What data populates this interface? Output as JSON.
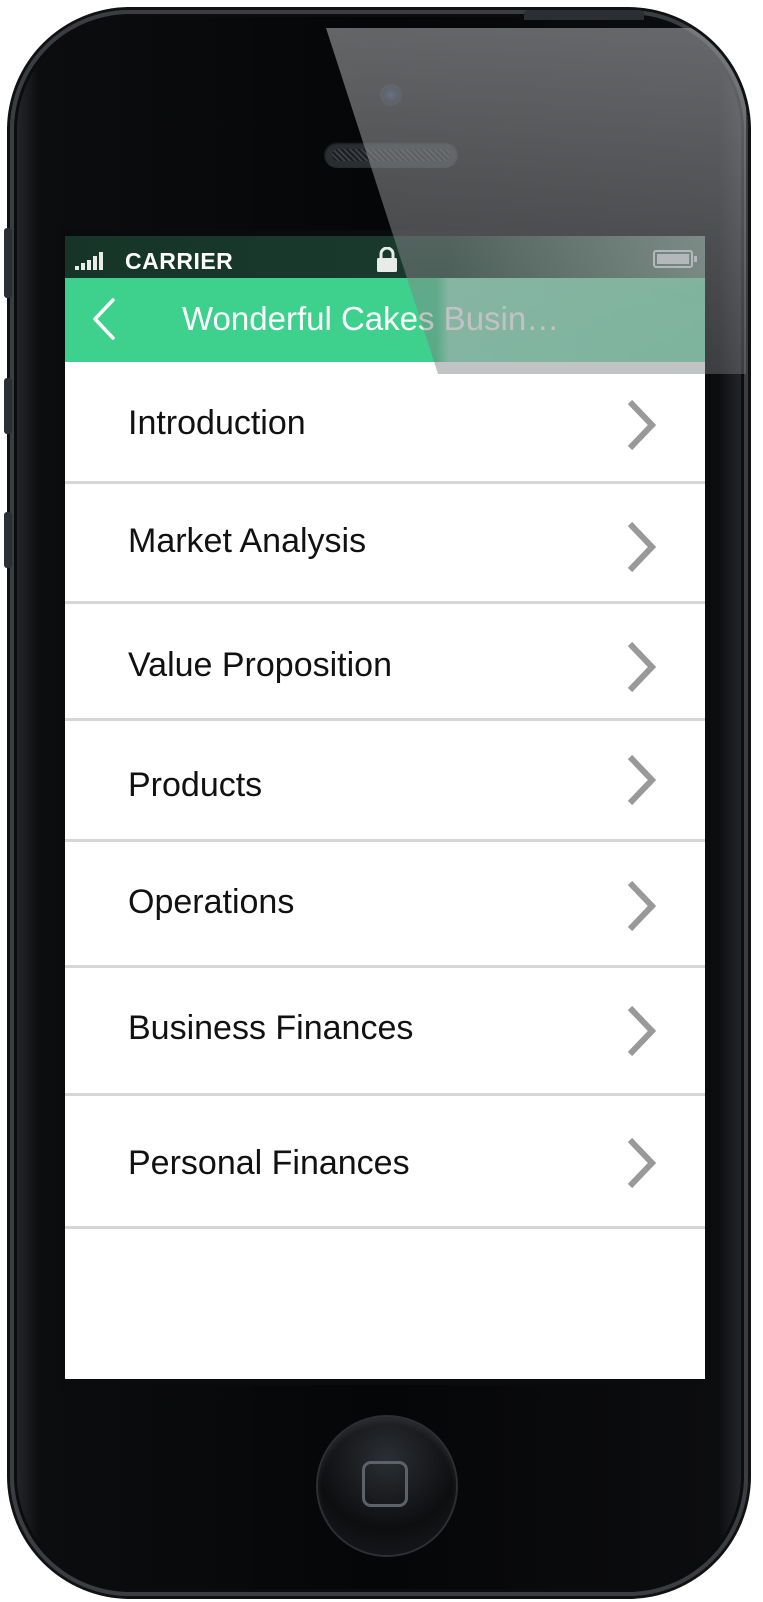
{
  "status_bar": {
    "carrier": "CARRIER",
    "signal_icon": "signal-bars-icon",
    "lock_icon": "lock-icon",
    "battery_icon": "battery-icon"
  },
  "nav": {
    "back_icon": "chevron-left-icon",
    "title": "Wonderful Cakes Busin…"
  },
  "menu": {
    "items": [
      {
        "label": "Introduction"
      },
      {
        "label": "Market Analysis"
      },
      {
        "label": "Value Proposition"
      },
      {
        "label": "Products"
      },
      {
        "label": "Operations"
      },
      {
        "label": "Business Finances"
      },
      {
        "label": "Personal Finances"
      }
    ],
    "item_icon": "chevron-right-icon"
  },
  "device": {
    "home_button_icon": "home-button-icon"
  },
  "colors": {
    "accent": "#3ed08d",
    "status_bar": "#163528",
    "divider": "#d6d6d6",
    "chevron": "#999999"
  }
}
